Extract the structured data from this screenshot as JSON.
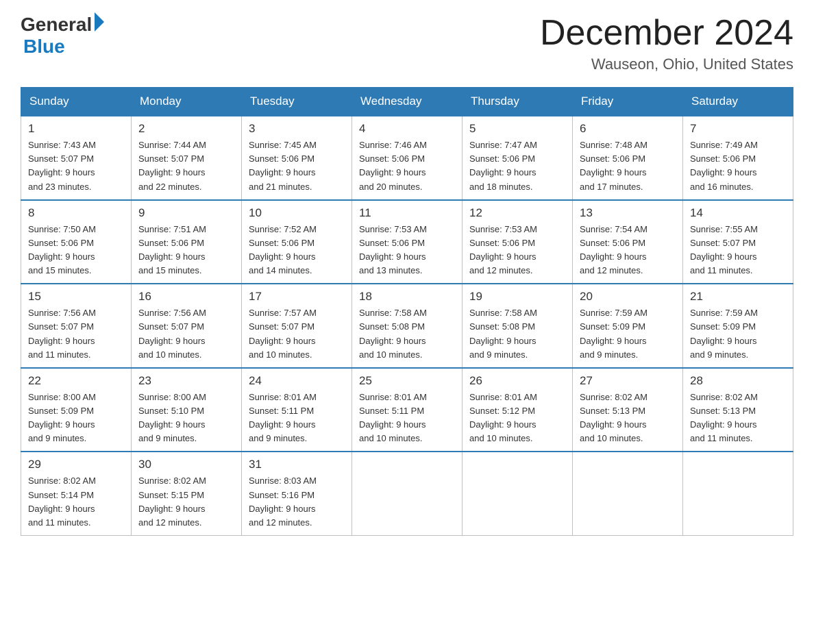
{
  "logo": {
    "general": "General",
    "blue": "Blue"
  },
  "title": "December 2024",
  "location": "Wauseon, Ohio, United States",
  "headers": [
    "Sunday",
    "Monday",
    "Tuesday",
    "Wednesday",
    "Thursday",
    "Friday",
    "Saturday"
  ],
  "weeks": [
    [
      {
        "day": "1",
        "sunrise": "7:43 AM",
        "sunset": "5:07 PM",
        "daylight": "9 hours and 23 minutes."
      },
      {
        "day": "2",
        "sunrise": "7:44 AM",
        "sunset": "5:07 PM",
        "daylight": "9 hours and 22 minutes."
      },
      {
        "day": "3",
        "sunrise": "7:45 AM",
        "sunset": "5:06 PM",
        "daylight": "9 hours and 21 minutes."
      },
      {
        "day": "4",
        "sunrise": "7:46 AM",
        "sunset": "5:06 PM",
        "daylight": "9 hours and 20 minutes."
      },
      {
        "day": "5",
        "sunrise": "7:47 AM",
        "sunset": "5:06 PM",
        "daylight": "9 hours and 18 minutes."
      },
      {
        "day": "6",
        "sunrise": "7:48 AM",
        "sunset": "5:06 PM",
        "daylight": "9 hours and 17 minutes."
      },
      {
        "day": "7",
        "sunrise": "7:49 AM",
        "sunset": "5:06 PM",
        "daylight": "9 hours and 16 minutes."
      }
    ],
    [
      {
        "day": "8",
        "sunrise": "7:50 AM",
        "sunset": "5:06 PM",
        "daylight": "9 hours and 15 minutes."
      },
      {
        "day": "9",
        "sunrise": "7:51 AM",
        "sunset": "5:06 PM",
        "daylight": "9 hours and 15 minutes."
      },
      {
        "day": "10",
        "sunrise": "7:52 AM",
        "sunset": "5:06 PM",
        "daylight": "9 hours and 14 minutes."
      },
      {
        "day": "11",
        "sunrise": "7:53 AM",
        "sunset": "5:06 PM",
        "daylight": "9 hours and 13 minutes."
      },
      {
        "day": "12",
        "sunrise": "7:53 AM",
        "sunset": "5:06 PM",
        "daylight": "9 hours and 12 minutes."
      },
      {
        "day": "13",
        "sunrise": "7:54 AM",
        "sunset": "5:06 PM",
        "daylight": "9 hours and 12 minutes."
      },
      {
        "day": "14",
        "sunrise": "7:55 AM",
        "sunset": "5:07 PM",
        "daylight": "9 hours and 11 minutes."
      }
    ],
    [
      {
        "day": "15",
        "sunrise": "7:56 AM",
        "sunset": "5:07 PM",
        "daylight": "9 hours and 11 minutes."
      },
      {
        "day": "16",
        "sunrise": "7:56 AM",
        "sunset": "5:07 PM",
        "daylight": "9 hours and 10 minutes."
      },
      {
        "day": "17",
        "sunrise": "7:57 AM",
        "sunset": "5:07 PM",
        "daylight": "9 hours and 10 minutes."
      },
      {
        "day": "18",
        "sunrise": "7:58 AM",
        "sunset": "5:08 PM",
        "daylight": "9 hours and 10 minutes."
      },
      {
        "day": "19",
        "sunrise": "7:58 AM",
        "sunset": "5:08 PM",
        "daylight": "9 hours and 9 minutes."
      },
      {
        "day": "20",
        "sunrise": "7:59 AM",
        "sunset": "5:09 PM",
        "daylight": "9 hours and 9 minutes."
      },
      {
        "day": "21",
        "sunrise": "7:59 AM",
        "sunset": "5:09 PM",
        "daylight": "9 hours and 9 minutes."
      }
    ],
    [
      {
        "day": "22",
        "sunrise": "8:00 AM",
        "sunset": "5:09 PM",
        "daylight": "9 hours and 9 minutes."
      },
      {
        "day": "23",
        "sunrise": "8:00 AM",
        "sunset": "5:10 PM",
        "daylight": "9 hours and 9 minutes."
      },
      {
        "day": "24",
        "sunrise": "8:01 AM",
        "sunset": "5:11 PM",
        "daylight": "9 hours and 9 minutes."
      },
      {
        "day": "25",
        "sunrise": "8:01 AM",
        "sunset": "5:11 PM",
        "daylight": "9 hours and 10 minutes."
      },
      {
        "day": "26",
        "sunrise": "8:01 AM",
        "sunset": "5:12 PM",
        "daylight": "9 hours and 10 minutes."
      },
      {
        "day": "27",
        "sunrise": "8:02 AM",
        "sunset": "5:13 PM",
        "daylight": "9 hours and 10 minutes."
      },
      {
        "day": "28",
        "sunrise": "8:02 AM",
        "sunset": "5:13 PM",
        "daylight": "9 hours and 11 minutes."
      }
    ],
    [
      {
        "day": "29",
        "sunrise": "8:02 AM",
        "sunset": "5:14 PM",
        "daylight": "9 hours and 11 minutes."
      },
      {
        "day": "30",
        "sunrise": "8:02 AM",
        "sunset": "5:15 PM",
        "daylight": "9 hours and 12 minutes."
      },
      {
        "day": "31",
        "sunrise": "8:03 AM",
        "sunset": "5:16 PM",
        "daylight": "9 hours and 12 minutes."
      },
      null,
      null,
      null,
      null
    ]
  ]
}
